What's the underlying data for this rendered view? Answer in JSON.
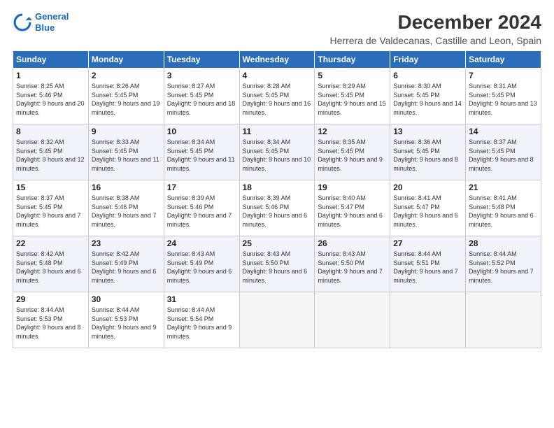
{
  "header": {
    "logo_line1": "General",
    "logo_line2": "Blue",
    "title": "December 2024",
    "subtitle": "Herrera de Valdecanas, Castille and Leon, Spain"
  },
  "weekdays": [
    "Sunday",
    "Monday",
    "Tuesday",
    "Wednesday",
    "Thursday",
    "Friday",
    "Saturday"
  ],
  "weeks": [
    [
      {
        "day": "1",
        "sunrise": "Sunrise: 8:25 AM",
        "sunset": "Sunset: 5:46 PM",
        "daylight": "Daylight: 9 hours and 20 minutes."
      },
      {
        "day": "2",
        "sunrise": "Sunrise: 8:26 AM",
        "sunset": "Sunset: 5:45 PM",
        "daylight": "Daylight: 9 hours and 19 minutes."
      },
      {
        "day": "3",
        "sunrise": "Sunrise: 8:27 AM",
        "sunset": "Sunset: 5:45 PM",
        "daylight": "Daylight: 9 hours and 18 minutes."
      },
      {
        "day": "4",
        "sunrise": "Sunrise: 8:28 AM",
        "sunset": "Sunset: 5:45 PM",
        "daylight": "Daylight: 9 hours and 16 minutes."
      },
      {
        "day": "5",
        "sunrise": "Sunrise: 8:29 AM",
        "sunset": "Sunset: 5:45 PM",
        "daylight": "Daylight: 9 hours and 15 minutes."
      },
      {
        "day": "6",
        "sunrise": "Sunrise: 8:30 AM",
        "sunset": "Sunset: 5:45 PM",
        "daylight": "Daylight: 9 hours and 14 minutes."
      },
      {
        "day": "7",
        "sunrise": "Sunrise: 8:31 AM",
        "sunset": "Sunset: 5:45 PM",
        "daylight": "Daylight: 9 hours and 13 minutes."
      }
    ],
    [
      {
        "day": "8",
        "sunrise": "Sunrise: 8:32 AM",
        "sunset": "Sunset: 5:45 PM",
        "daylight": "Daylight: 9 hours and 12 minutes."
      },
      {
        "day": "9",
        "sunrise": "Sunrise: 8:33 AM",
        "sunset": "Sunset: 5:45 PM",
        "daylight": "Daylight: 9 hours and 11 minutes."
      },
      {
        "day": "10",
        "sunrise": "Sunrise: 8:34 AM",
        "sunset": "Sunset: 5:45 PM",
        "daylight": "Daylight: 9 hours and 11 minutes."
      },
      {
        "day": "11",
        "sunrise": "Sunrise: 8:34 AM",
        "sunset": "Sunset: 5:45 PM",
        "daylight": "Daylight: 9 hours and 10 minutes."
      },
      {
        "day": "12",
        "sunrise": "Sunrise: 8:35 AM",
        "sunset": "Sunset: 5:45 PM",
        "daylight": "Daylight: 9 hours and 9 minutes."
      },
      {
        "day": "13",
        "sunrise": "Sunrise: 8:36 AM",
        "sunset": "Sunset: 5:45 PM",
        "daylight": "Daylight: 9 hours and 8 minutes."
      },
      {
        "day": "14",
        "sunrise": "Sunrise: 8:37 AM",
        "sunset": "Sunset: 5:45 PM",
        "daylight": "Daylight: 9 hours and 8 minutes."
      }
    ],
    [
      {
        "day": "15",
        "sunrise": "Sunrise: 8:37 AM",
        "sunset": "Sunset: 5:45 PM",
        "daylight": "Daylight: 9 hours and 7 minutes."
      },
      {
        "day": "16",
        "sunrise": "Sunrise: 8:38 AM",
        "sunset": "Sunset: 5:46 PM",
        "daylight": "Daylight: 9 hours and 7 minutes."
      },
      {
        "day": "17",
        "sunrise": "Sunrise: 8:39 AM",
        "sunset": "Sunset: 5:46 PM",
        "daylight": "Daylight: 9 hours and 7 minutes."
      },
      {
        "day": "18",
        "sunrise": "Sunrise: 8:39 AM",
        "sunset": "Sunset: 5:46 PM",
        "daylight": "Daylight: 9 hours and 6 minutes."
      },
      {
        "day": "19",
        "sunrise": "Sunrise: 8:40 AM",
        "sunset": "Sunset: 5:47 PM",
        "daylight": "Daylight: 9 hours and 6 minutes."
      },
      {
        "day": "20",
        "sunrise": "Sunrise: 8:41 AM",
        "sunset": "Sunset: 5:47 PM",
        "daylight": "Daylight: 9 hours and 6 minutes."
      },
      {
        "day": "21",
        "sunrise": "Sunrise: 8:41 AM",
        "sunset": "Sunset: 5:48 PM",
        "daylight": "Daylight: 9 hours and 6 minutes."
      }
    ],
    [
      {
        "day": "22",
        "sunrise": "Sunrise: 8:42 AM",
        "sunset": "Sunset: 5:48 PM",
        "daylight": "Daylight: 9 hours and 6 minutes."
      },
      {
        "day": "23",
        "sunrise": "Sunrise: 8:42 AM",
        "sunset": "Sunset: 5:49 PM",
        "daylight": "Daylight: 9 hours and 6 minutes."
      },
      {
        "day": "24",
        "sunrise": "Sunrise: 8:43 AM",
        "sunset": "Sunset: 5:49 PM",
        "daylight": "Daylight: 9 hours and 6 minutes."
      },
      {
        "day": "25",
        "sunrise": "Sunrise: 8:43 AM",
        "sunset": "Sunset: 5:50 PM",
        "daylight": "Daylight: 9 hours and 6 minutes."
      },
      {
        "day": "26",
        "sunrise": "Sunrise: 8:43 AM",
        "sunset": "Sunset: 5:50 PM",
        "daylight": "Daylight: 9 hours and 7 minutes."
      },
      {
        "day": "27",
        "sunrise": "Sunrise: 8:44 AM",
        "sunset": "Sunset: 5:51 PM",
        "daylight": "Daylight: 9 hours and 7 minutes."
      },
      {
        "day": "28",
        "sunrise": "Sunrise: 8:44 AM",
        "sunset": "Sunset: 5:52 PM",
        "daylight": "Daylight: 9 hours and 7 minutes."
      }
    ],
    [
      {
        "day": "29",
        "sunrise": "Sunrise: 8:44 AM",
        "sunset": "Sunset: 5:53 PM",
        "daylight": "Daylight: 9 hours and 8 minutes."
      },
      {
        "day": "30",
        "sunrise": "Sunrise: 8:44 AM",
        "sunset": "Sunset: 5:53 PM",
        "daylight": "Daylight: 9 hours and 9 minutes."
      },
      {
        "day": "31",
        "sunrise": "Sunrise: 8:44 AM",
        "sunset": "Sunset: 5:54 PM",
        "daylight": "Daylight: 9 hours and 9 minutes."
      },
      null,
      null,
      null,
      null
    ]
  ]
}
